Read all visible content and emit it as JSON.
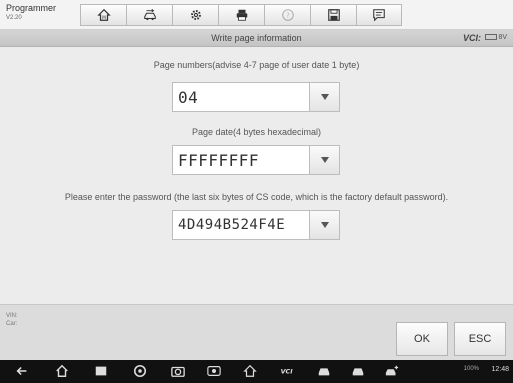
{
  "app": {
    "title": "Programmer",
    "version": "V2.20"
  },
  "toolbar": {
    "buttons": [
      {
        "icon": "home-icon"
      },
      {
        "icon": "vehicle-swap-icon"
      },
      {
        "icon": "gear-icon"
      },
      {
        "icon": "print-icon"
      },
      {
        "icon": "help-icon",
        "disabled": true
      },
      {
        "icon": "save-icon"
      },
      {
        "icon": "message-icon"
      }
    ]
  },
  "header": {
    "page_title": "Write page information",
    "vci_label": "VCI:",
    "battery_text": "8V"
  },
  "form": {
    "page_numbers_label": "Page numbers(advise 4-7 page of user date 1 byte)",
    "page_numbers_value": "04",
    "page_date_label": "Page date(4 bytes hexadecimal)",
    "page_date_value": "FFFFFFFF",
    "password_label": "Please enter the password (the last six bytes of CS code, which is the factory default password).",
    "password_value": "4D494B524F4E"
  },
  "vehicle_info": {
    "vin_label": "VIN:",
    "car_label": "Car:"
  },
  "buttons": {
    "ok": "OK",
    "esc": "ESC"
  },
  "system_bar": {
    "clock": "12:48",
    "battery": "100%"
  }
}
